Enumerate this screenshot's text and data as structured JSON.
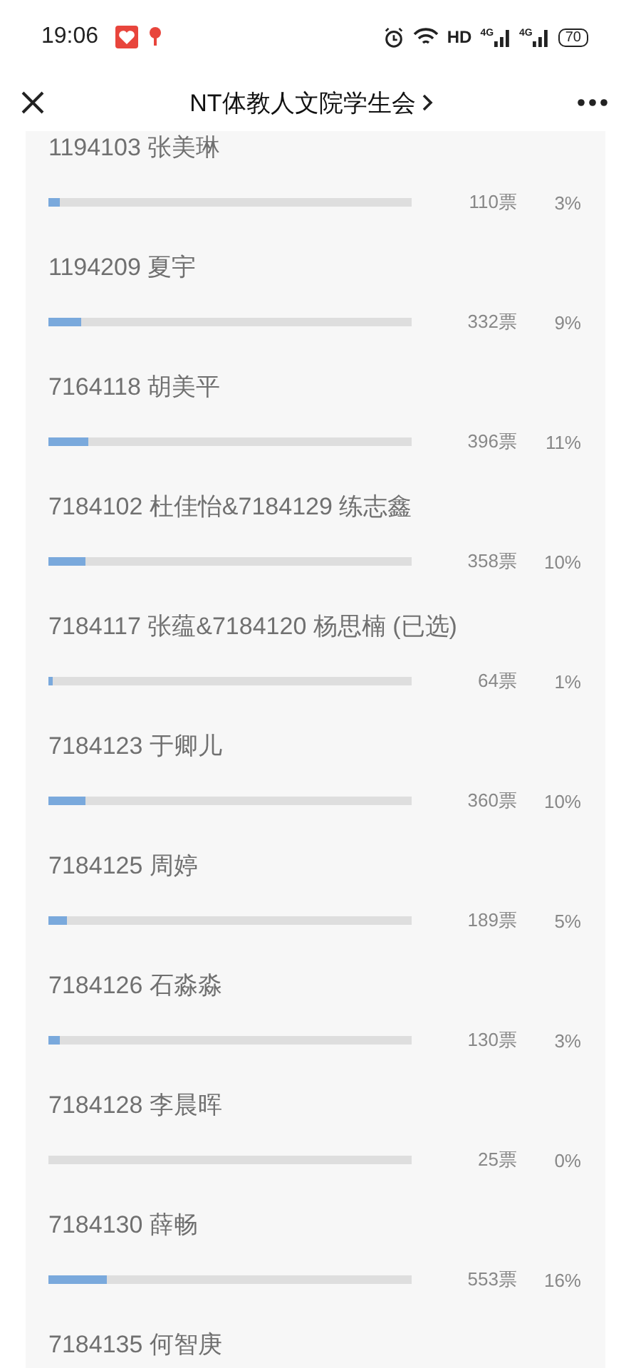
{
  "status_bar": {
    "time": "19:06",
    "network_label": "HD",
    "signal_labels": [
      "4G",
      "4G"
    ],
    "battery": "70"
  },
  "header": {
    "title": "NT体教人文院学生会"
  },
  "options": [
    {
      "name": "1194103 张美琳",
      "level": 0.03,
      "votes": "110票",
      "percent": "3%"
    },
    {
      "name": "1194209 夏宇",
      "level": 0.09,
      "votes": "332票",
      "percent": "9%"
    },
    {
      "name": "7164118 胡美平",
      "level": 0.11,
      "votes": "396票",
      "percent": "11%"
    },
    {
      "name": "7184102 杜佳怡&7184129 练志鑫",
      "level": 0.1,
      "votes": "358票",
      "percent": "10%"
    },
    {
      "name": "7184117 张蕴&7184120 杨思楠 (已选)",
      "level": 0.01,
      "votes": "64票",
      "percent": "1%"
    },
    {
      "name": "7184123 于卿儿",
      "level": 0.1,
      "votes": "360票",
      "percent": "10%"
    },
    {
      "name": "7184125 周婷",
      "level": 0.05,
      "votes": "189票",
      "percent": "5%"
    },
    {
      "name": "7184126 石淼淼",
      "level": 0.03,
      "votes": "130票",
      "percent": "3%"
    },
    {
      "name": "7184128 李晨晖",
      "level": 0,
      "votes": "25票",
      "percent": "0%"
    },
    {
      "name": "7184130 薛畅",
      "level": 0.16,
      "votes": "553票",
      "percent": "16%"
    },
    {
      "name": "7184135 何智庚"
    }
  ]
}
